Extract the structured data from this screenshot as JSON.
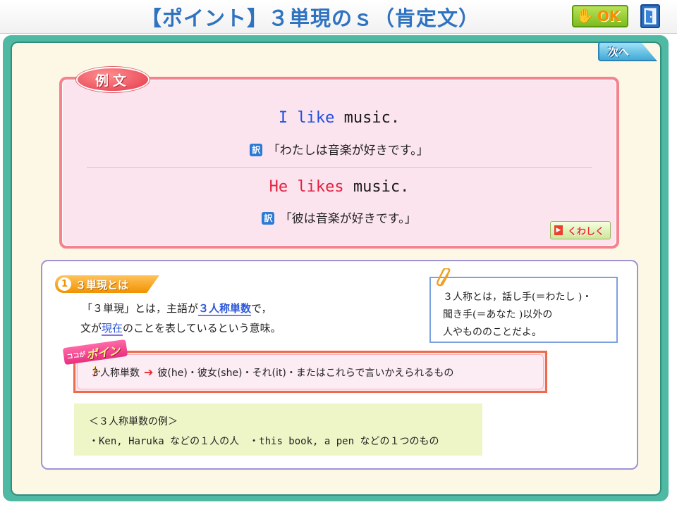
{
  "header": {
    "title": "【ポイント】３単現のｓ（肯定文）",
    "ok_label": "OK"
  },
  "nav": {
    "next_label": "次へ"
  },
  "example": {
    "badge": "例文",
    "sentence1": {
      "subject": "I",
      "verb": "like",
      "object": "music."
    },
    "translation1": "「わたしは音楽が好きです。」",
    "sentence2": {
      "subject": "He",
      "verb": "likes",
      "object": "music."
    },
    "translation2": "「彼は音楽が好きです。」",
    "yaku_icon": "訳",
    "detail_label": "くわしく"
  },
  "section1": {
    "number": "1",
    "title": "３単現とは",
    "line1_pre": "「３単現」とは，主語が",
    "line1_hl": "３人称単数",
    "line1_post": "で，",
    "line2_pre": "文が",
    "line2_hl": "現在",
    "line2_post": "のことを表しているという意味。"
  },
  "note": {
    "line1": "３人称とは，話し手(＝わたし )・",
    "line2": "聞き手(＝あなた )以外の",
    "line3": "人やもののことだよ。"
  },
  "point": {
    "badge_small": "ココが",
    "badge_big": "ポイント",
    "label": "３人称単数",
    "arrow": "➔",
    "text": "彼(he)・彼女(she)・それ(it)・またはこれらで言いかえられるもの"
  },
  "examples_list": {
    "heading": "＜３人称単数の例＞",
    "item1": "・Ken, Haruka などの１人の人",
    "item2": "・this book, a pen などの１つのもの"
  },
  "colors": {
    "title_blue": "#2f73c0",
    "frame_teal": "#50b9a3",
    "example_border": "#f3838f",
    "emphasis_red": "#e32140",
    "emphasis_blue": "#1f4fe0"
  }
}
